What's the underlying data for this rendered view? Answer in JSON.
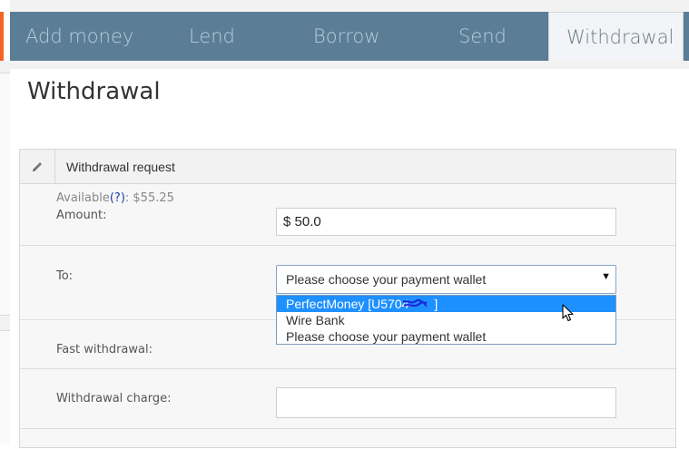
{
  "tabs": [
    {
      "label": "Add money"
    },
    {
      "label": "Lend"
    },
    {
      "label": "Borrow"
    },
    {
      "label": "Send"
    },
    {
      "label": "Withdrawal",
      "active": true
    }
  ],
  "page": {
    "title": "Withdrawal"
  },
  "panel": {
    "title": "Withdrawal request",
    "icon": "pencil-icon",
    "available": {
      "label": "Available",
      "help": "(?)",
      "value": ": $55.25"
    },
    "amount": {
      "label": "Amount:",
      "value": "$ 50.0"
    },
    "to": {
      "label": "To:",
      "selected": "Please choose your payment wallet",
      "options": [
        "PerfectMoney [U5704",
        "Wire Bank",
        "Please choose your payment wallet"
      ],
      "highlighted_option_suffix": "]"
    },
    "fast_withdrawal": {
      "label": "Fast withdrawal:"
    },
    "withdrawal_charge": {
      "label": "Withdrawal charge:",
      "value": ""
    }
  },
  "colors": {
    "accent_orange": "#f26522",
    "tabbar_bg": "#5b7d96",
    "tab_text": "#b9cdde",
    "option_highlight": "#1e90ff"
  }
}
